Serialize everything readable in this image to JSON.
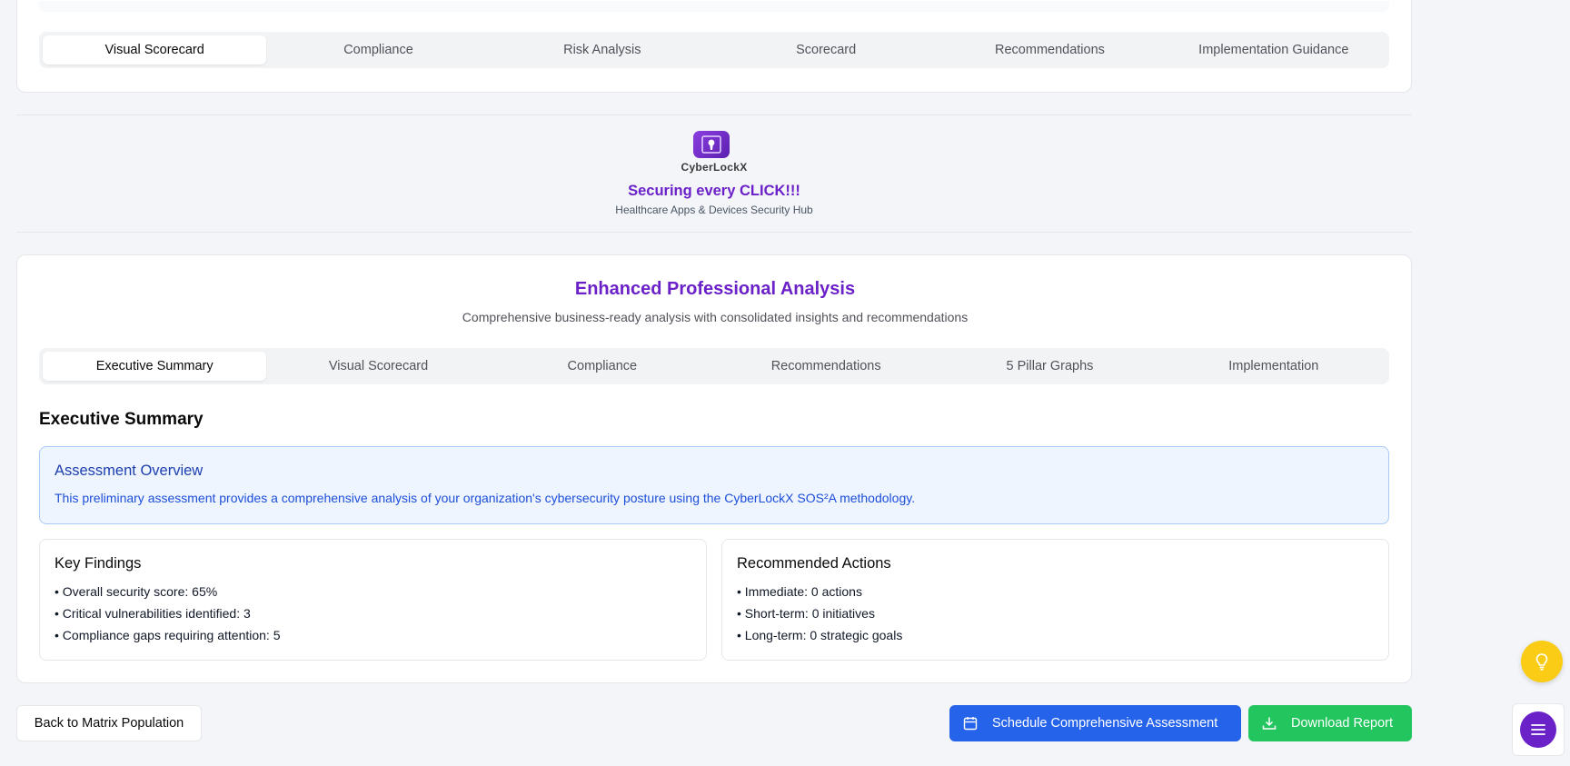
{
  "top_tabs": [
    {
      "label": "Visual Scorecard",
      "active": true
    },
    {
      "label": "Compliance"
    },
    {
      "label": "Risk Analysis"
    },
    {
      "label": "Scorecard"
    },
    {
      "label": "Recommendations"
    },
    {
      "label": "Implementation Guidance"
    }
  ],
  "brand": {
    "logo_text": "CyberLockX",
    "tagline": "Securing every CLICK!!!",
    "subtitle": "Healthcare Apps & Devices Security Hub"
  },
  "analysis": {
    "title": "Enhanced Professional Analysis",
    "subtitle": "Comprehensive business-ready analysis with consolidated insights and recommendations",
    "tabs": [
      {
        "label": "Executive Summary",
        "active": true
      },
      {
        "label": "Visual Scorecard"
      },
      {
        "label": "Compliance"
      },
      {
        "label": "Recommendations"
      },
      {
        "label": "5 Pillar Graphs"
      },
      {
        "label": "Implementation"
      }
    ],
    "section_title": "Executive Summary",
    "overview": {
      "title": "Assessment Overview",
      "text": "This preliminary assessment provides a comprehensive analysis of your organization's cybersecurity posture using the CyberLockX SOS²A methodology."
    },
    "key_findings": {
      "title": "Key Findings",
      "items": [
        "• Overall security score: 65%",
        "• Critical vulnerabilities identified: 3",
        "• Compliance gaps requiring attention: 5"
      ]
    },
    "recommended_actions": {
      "title": "Recommended Actions",
      "items": [
        "• Immediate: 0 actions",
        "• Short-term: 0 initiatives",
        "• Long-term: 0 strategic goals"
      ]
    }
  },
  "buttons": {
    "back": "Back to Matrix Population",
    "schedule": "Schedule Comprehensive Assessment",
    "download": "Download Report"
  },
  "icons": {
    "schedule": "calendar-icon",
    "download": "download-icon",
    "tip": "lightbulb-icon",
    "menu": "menu-icon",
    "logo": "keyhole-lock-icon"
  },
  "colors": {
    "brand_purple": "#6b21c8",
    "primary_blue": "#2563eb",
    "success_green": "#22c55e",
    "tip_yellow": "#facc15"
  }
}
